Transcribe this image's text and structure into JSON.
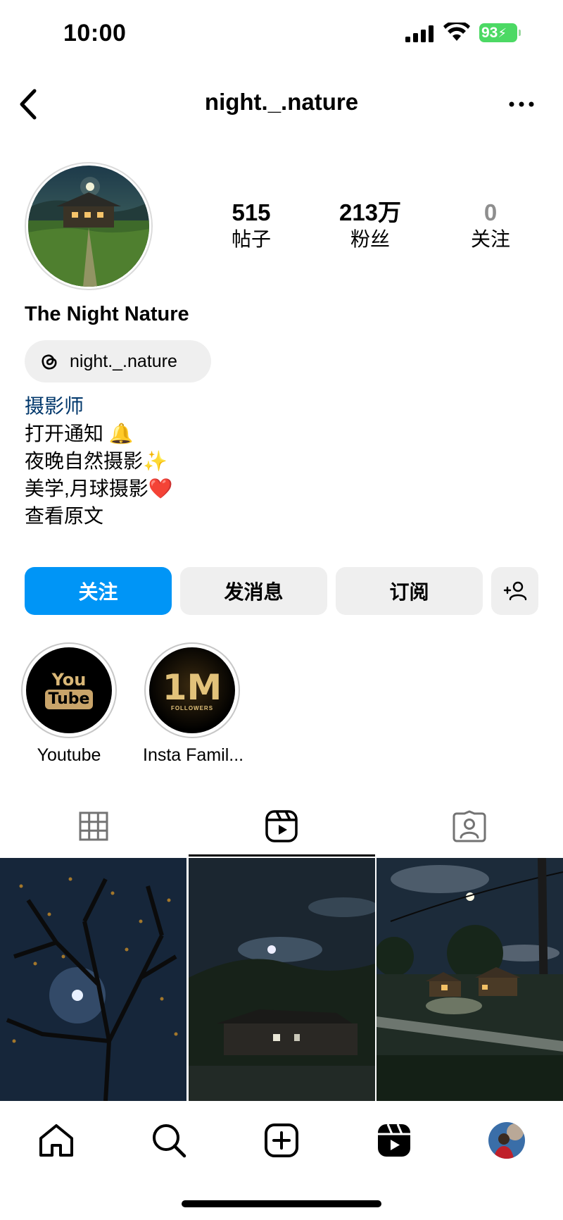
{
  "status_bar": {
    "time": "10:00",
    "battery": "93"
  },
  "header": {
    "title": "night._.nature",
    "back_icon": "chevron-left-icon",
    "more_icon": "more-horizontal-icon"
  },
  "profile": {
    "display_name": "The Night Nature",
    "threads_handle": "night._.nature",
    "stats": [
      {
        "value": "515",
        "label": "帖子"
      },
      {
        "value": "213万",
        "label": "粉丝"
      },
      {
        "value": "0",
        "label": "关注"
      }
    ],
    "bio": {
      "category": "摄影师",
      "lines": [
        "打开通知 🔔",
        "夜晚自然摄影✨",
        "美学,月球摄影❤️"
      ],
      "see_translation": "查看原文"
    }
  },
  "actions": {
    "follow": "关注",
    "message": "发消息",
    "subscribe": "订阅"
  },
  "highlights": [
    {
      "label": "Youtube",
      "badge_line1": "You",
      "badge_line2": "Tube"
    },
    {
      "label": "Insta Famil...",
      "badge_main": "1M",
      "badge_sub": "FOLLOWERS"
    }
  ],
  "tabs": [
    {
      "name": "posts",
      "icon": "grid-icon"
    },
    {
      "name": "reels",
      "icon": "reels-icon",
      "active": true
    },
    {
      "name": "tagged",
      "icon": "tagged-icon"
    }
  ],
  "grid_posts": [
    {
      "description": "bare tree with moon at night"
    },
    {
      "description": "moonlit village house"
    },
    {
      "description": "lit farmhouse at night"
    }
  ],
  "bottom_nav": [
    "home-icon",
    "search-icon",
    "create-icon",
    "reels-icon",
    "profile-avatar"
  ],
  "colors": {
    "accent": "#0095f6",
    "category": "#00376b",
    "button_gray": "#efefef"
  }
}
